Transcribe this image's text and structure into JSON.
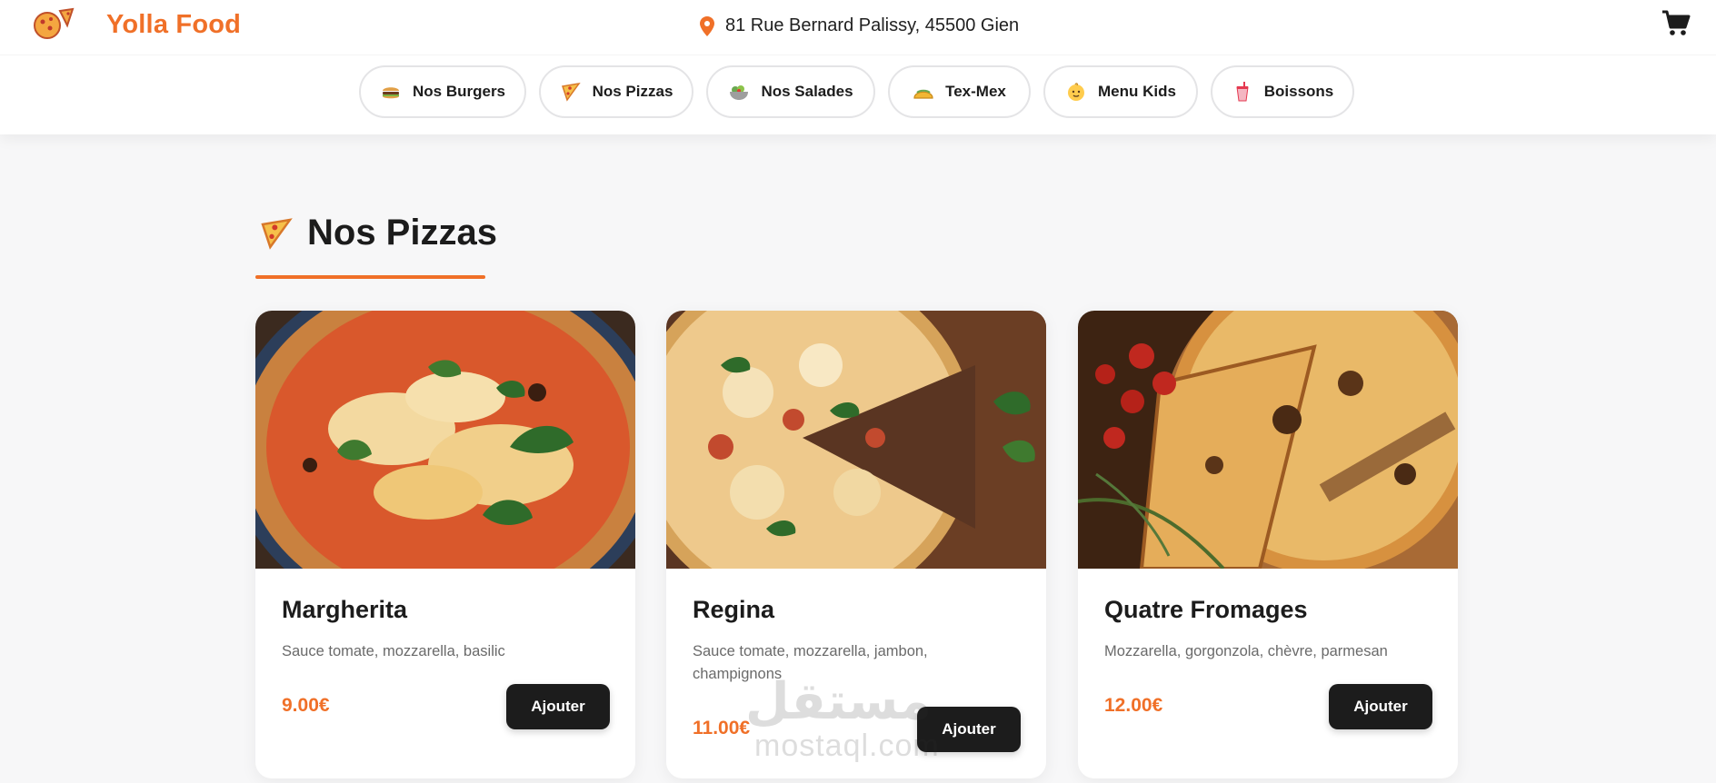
{
  "header": {
    "brand": "Yolla Food",
    "logo_text": "Yolla FOOD",
    "address": "81 Rue Bernard Palissy, 45500 Gien",
    "icons": {
      "location": "map-pin-icon",
      "cart": "shopping-cart-icon"
    }
  },
  "nav": {
    "items": [
      {
        "label": "Nos Burgers",
        "icon": "burger-icon"
      },
      {
        "label": "Nos Pizzas",
        "icon": "pizza-slice-icon"
      },
      {
        "label": "Nos Salades",
        "icon": "salad-bowl-icon"
      },
      {
        "label": "Tex-Mex",
        "icon": "taco-icon"
      },
      {
        "label": "Menu Kids",
        "icon": "baby-face-icon"
      },
      {
        "label": "Boissons",
        "icon": "drink-cup-icon"
      }
    ]
  },
  "section": {
    "title": "Nos Pizzas",
    "icon": "pizza-slice-icon"
  },
  "products": [
    {
      "name": "Margherita",
      "description": "Sauce tomate, mozzarella, basilic",
      "price": "9.00€",
      "button": "Ajouter"
    },
    {
      "name": "Regina",
      "description": "Sauce tomate, mozzarella, jambon, champignons",
      "price": "11.00€",
      "button": "Ajouter"
    },
    {
      "name": "Quatre Fromages",
      "description": "Mozzarella, gorgonzola, chèvre, parmesan",
      "price": "12.00€",
      "button": "Ajouter"
    }
  ],
  "watermark": {
    "arabic": "مستقل",
    "latin": "mostaql.com"
  },
  "colors": {
    "accent": "#f07028",
    "button": "#1c1c1c",
    "background": "#f7f7f8"
  }
}
